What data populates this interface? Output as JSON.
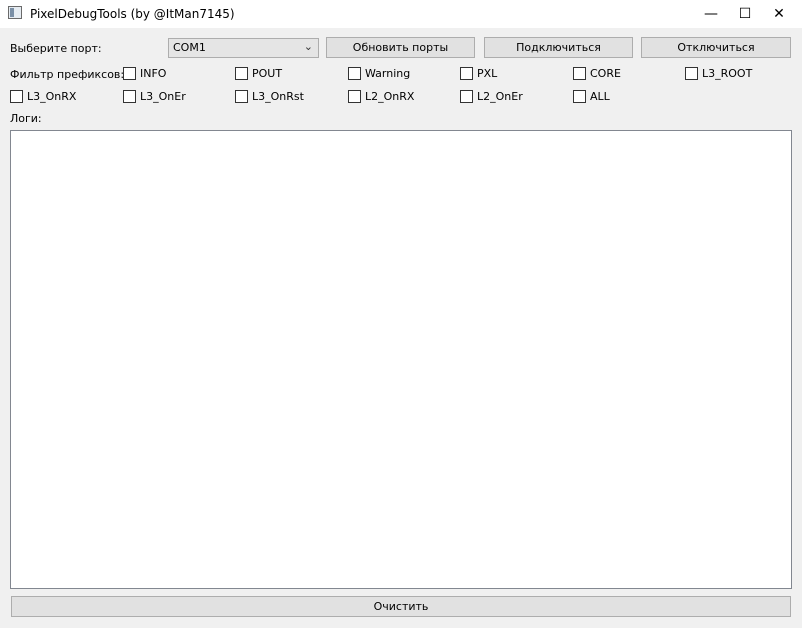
{
  "window": {
    "title": "PixelDebugTools (by @ItMan7145)",
    "minimize": "—",
    "maximize": "☐",
    "close": "✕"
  },
  "port": {
    "label": "Выберите порт:",
    "selected": "COM1",
    "refresh_label": "Обновить порты",
    "connect_label": "Подключиться",
    "disconnect_label": "Отключиться"
  },
  "filter": {
    "label": "Фильтр префиксов:",
    "options": [
      "INFO",
      "POUT",
      "Warning",
      "PXL",
      "CORE",
      "L3_ROOT",
      "L3_OnRX",
      "L3_OnEr",
      "L3_OnRst",
      "L2_OnRX",
      "L2_OnEr",
      "ALL"
    ]
  },
  "logs": {
    "label": "Логи:"
  },
  "clear_label": "Очистить"
}
